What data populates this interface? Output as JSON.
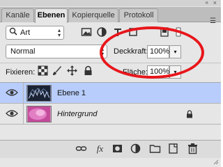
{
  "window": {
    "collapse_glyph": "«",
    "close_glyph": "×",
    "menu_glyph": "☰"
  },
  "tabs": [
    {
      "label": "Kanäle",
      "active": false
    },
    {
      "label": "Ebenen",
      "active": true
    },
    {
      "label": "Kopierquelle",
      "active": false
    },
    {
      "label": "Protokoll",
      "active": false
    }
  ],
  "filter": {
    "kind_label": "Art",
    "icons": [
      "image-filter-icon",
      "adjustment-filter-icon",
      "type-filter-icon",
      "shape-filter-icon",
      "smart-object-filter-icon",
      "filter-toggle-icon"
    ]
  },
  "blend": {
    "mode": "Normal",
    "opacity_label": "Deckkraft:",
    "opacity_value": "100%",
    "opacity_arrow": "▾"
  },
  "lock": {
    "label": "Fixieren:",
    "fill_label": "Fläche:",
    "fill_value": "100%",
    "fill_arrow": "▾",
    "icons": [
      "lock-transparent-pixels-icon",
      "lock-image-pixels-icon",
      "lock-position-icon",
      "lock-all-icon"
    ]
  },
  "layers": [
    {
      "name": "Ebene 1",
      "selected": true,
      "visible": true,
      "locked": false
    },
    {
      "name": "Hintergrund",
      "selected": false,
      "visible": true,
      "locked": true
    }
  ],
  "bottom_bar": {
    "icons": [
      "link-layers-icon",
      "fx-icon",
      "layer-mask-icon",
      "adjustment-layer-icon",
      "new-group-icon",
      "new-layer-icon",
      "trash-icon"
    ],
    "fx_label": "fx"
  },
  "colors": {
    "selection": "#b8cdfb",
    "annotation_red": "#e8161b",
    "panel_bg": "#e6e6e6"
  }
}
